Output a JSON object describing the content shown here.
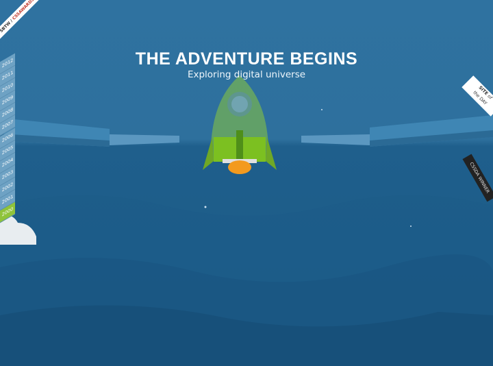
{
  "hero": {
    "title": "THE ADVENTURE BEGINS",
    "subtitle": "Exploring digital universe"
  },
  "corner_ribbon": {
    "left": "SBTW",
    "right": "CSSAWARDS"
  },
  "timeline": {
    "years": [
      "2012",
      "2011",
      "2010",
      "2009",
      "2008",
      "2007",
      "2006",
      "2005",
      "2004",
      "2003",
      "2002",
      "2001",
      "2000"
    ],
    "active": "2000"
  },
  "badges": {
    "sotd_line1": "SITE",
    "sotd_of": "of",
    "sotd_line2": "the DAY",
    "cssda_label": "CSSDA",
    "cssda_winner": "WINNER"
  },
  "colors": {
    "sky": "#2f72a0",
    "ocean": "#1b5a86",
    "rocket_green": "#7cc021",
    "flame": "#f39a1e",
    "active_year": "#8fc33a"
  },
  "icons": {
    "rocket": "rocket-icon",
    "cloud": "cloud-icon"
  }
}
